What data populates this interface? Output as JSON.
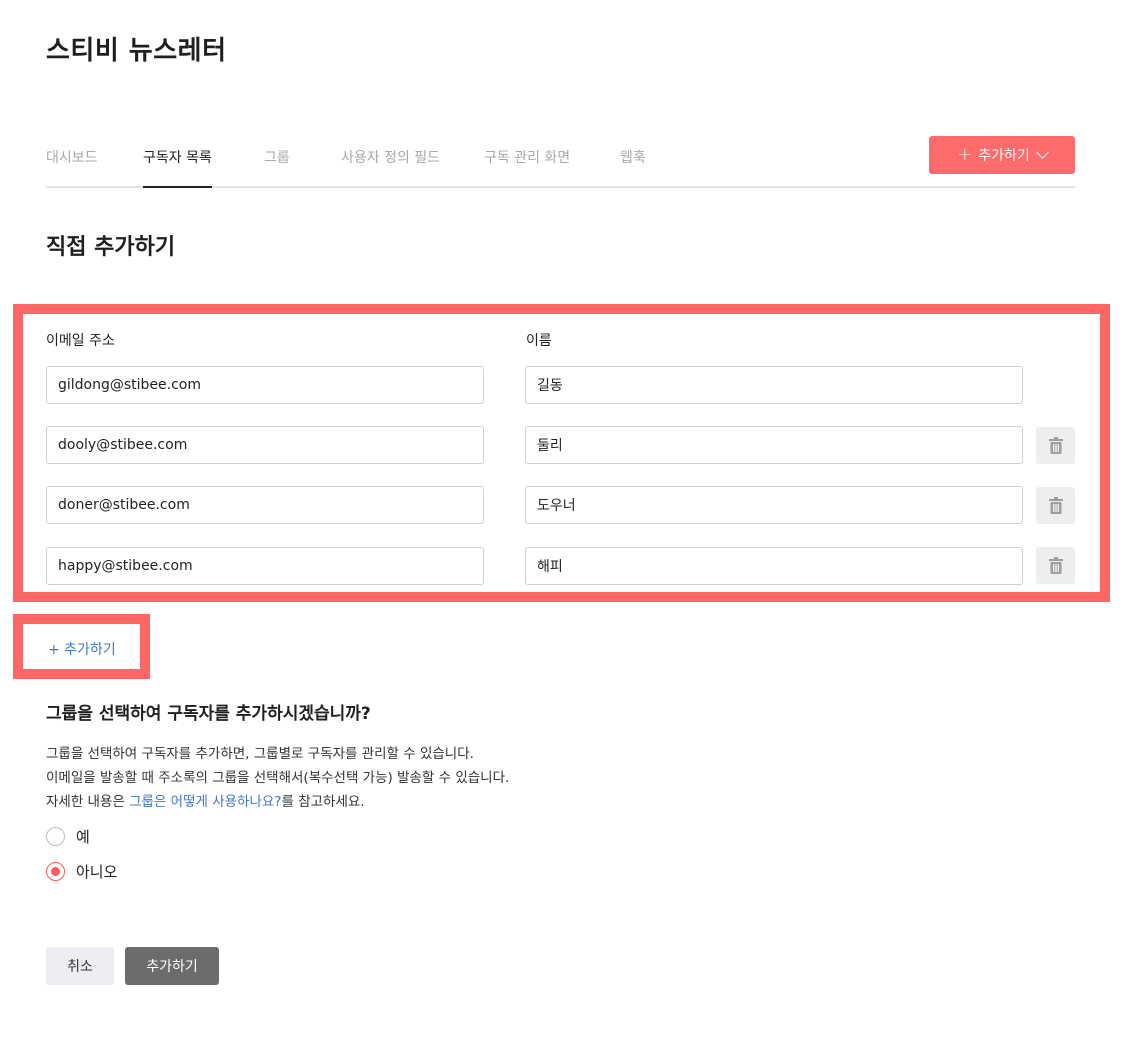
{
  "app": {
    "title": "스티비 뉴스레터"
  },
  "tabs": [
    {
      "label": "대시보드",
      "active": false
    },
    {
      "label": "구독자 목록",
      "active": true
    },
    {
      "label": "그룹",
      "active": false
    },
    {
      "label": "사용자 정의 필드",
      "active": false
    },
    {
      "label": "구독 관리 화면",
      "active": false
    },
    {
      "label": "웹훅",
      "active": false
    }
  ],
  "header_action": {
    "plus_icon": "+",
    "label": "추가하기",
    "icon": "chevron-down-icon"
  },
  "section": {
    "title": "직접 추가하기"
  },
  "columns": {
    "email": "이메일 주소",
    "name": "이름"
  },
  "rows": [
    {
      "email": "gildong@stibee.com",
      "name": "길동",
      "deletable": false
    },
    {
      "email": "dooly@stibee.com",
      "name": "둘리",
      "deletable": true
    },
    {
      "email": "doner@stibee.com",
      "name": "도우너",
      "deletable": true
    },
    {
      "email": "happy@stibee.com",
      "name": "해피",
      "deletable": true
    }
  ],
  "add_row": {
    "label": "+ 추가하기"
  },
  "group_section": {
    "question": "그룹을 선택하여 구독자를 추가하시겠습니까?",
    "line1": "그룹을 선택하여 구독자를 추가하면, 그룹별로 구독자를 관리할 수 있습니다.",
    "line2": "이메일을 발송할 때 주소록의 그룹을 선택해서(복수선택 가능) 발송할 수 있습니다.",
    "line3_prefix": "자세한 내용은 ",
    "line3_link": "그룹은 어떻게 사용하나요?",
    "line3_suffix": "를 참고하세요."
  },
  "radios": {
    "yes": "예",
    "no": "아니오",
    "selected": "no"
  },
  "footer": {
    "cancel": "취소",
    "submit": "추가하기"
  },
  "colors": {
    "accent": "#ff6b6b",
    "link": "#3c78d8",
    "highlight": "#ff6666",
    "submit_bg": "#6c6c6c"
  }
}
